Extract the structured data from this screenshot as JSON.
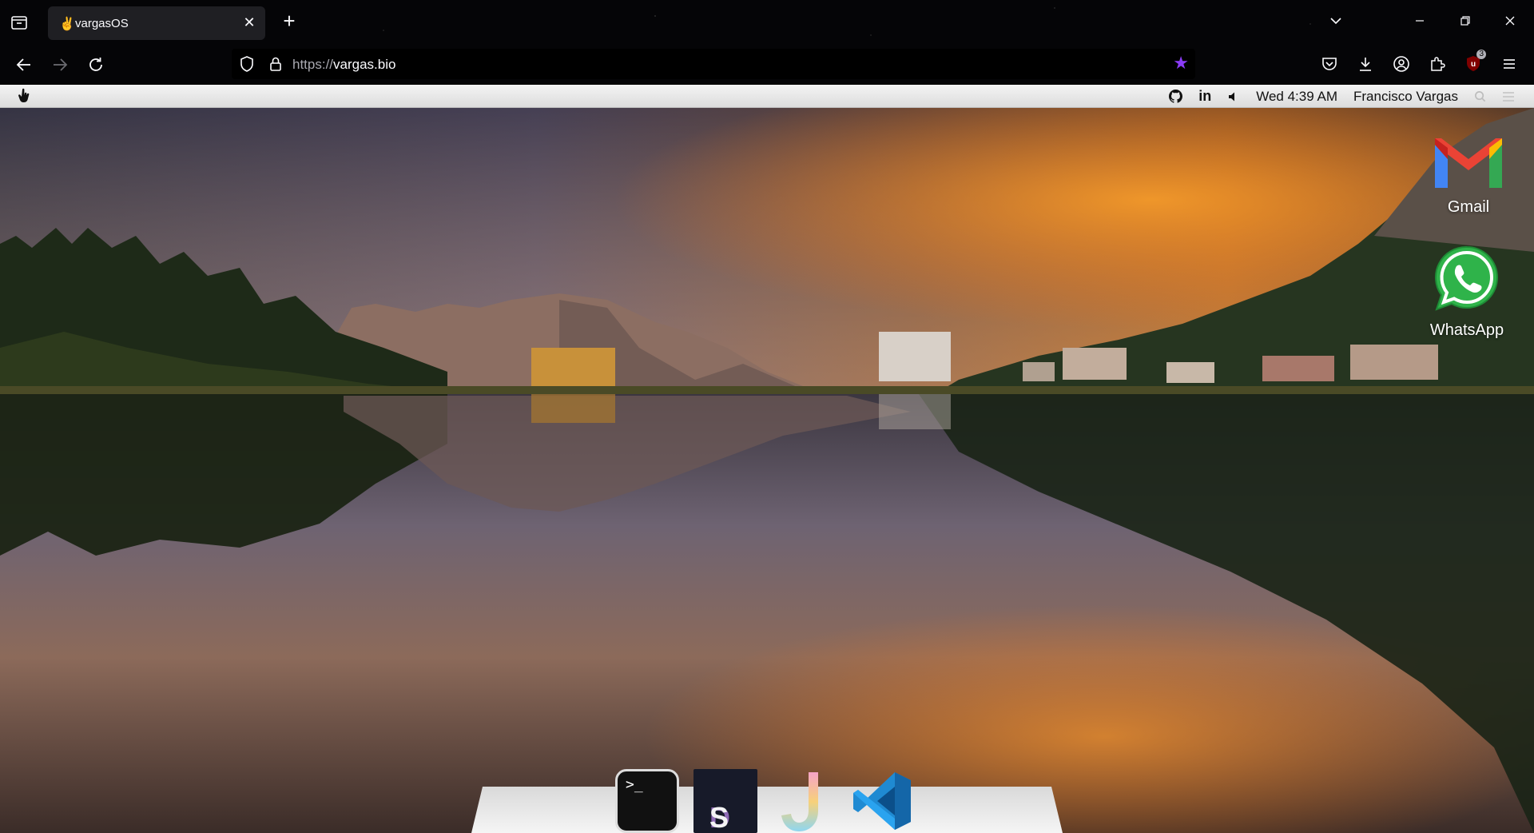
{
  "browser": {
    "tab": {
      "title": "vargasOS",
      "favicon": "hand-peace-icon"
    },
    "url": {
      "protocol": "https://",
      "host": "vargas.bio"
    },
    "toolbar_icons": [
      "pocket-icon",
      "download-icon",
      "account-icon",
      "extensions-icon",
      "ublock-icon",
      "menu-icon"
    ],
    "extension_badge": "3"
  },
  "os_bar": {
    "logo": "hand-cursor-icon",
    "status_icons": [
      "github-icon",
      "linkedin-icon",
      "volume-icon"
    ],
    "linkedin_text": "in",
    "clock": "Wed 4:39 AM",
    "user": "Francisco Vargas"
  },
  "desktop_icons": [
    {
      "label": "Gmail",
      "icon": "gmail-icon"
    },
    {
      "label": "WhatsApp",
      "icon": "whatsapp-icon"
    }
  ],
  "dock": {
    "terminal_prompt": ">_",
    "ds_text": {
      "d": "D",
      "s": "S"
    },
    "items": [
      "terminal-icon",
      "datastation-icon",
      "jupyter-icon",
      "vscode-icon"
    ]
  },
  "colors": {
    "accent_star": "#8b3cf6",
    "os_bar": "#e8e8e8",
    "chrome": "#050507"
  }
}
